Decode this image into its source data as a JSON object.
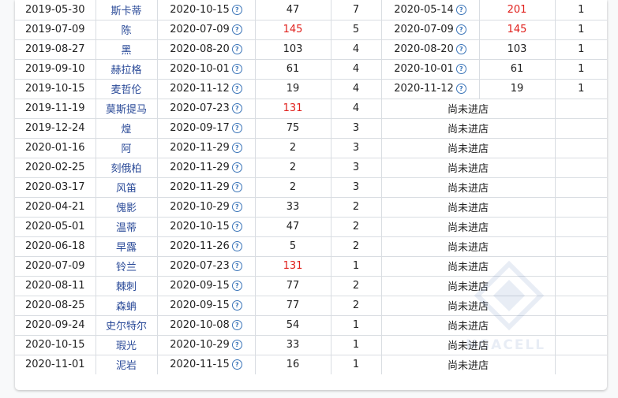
{
  "colors": {
    "accent": "#2a4a98",
    "highlight_red": "#e0201c",
    "border": "#d9dde2",
    "help_icon": "#3a74b8"
  },
  "icons": {
    "date_help": "question-circle-icon"
  },
  "rows": [
    {
      "release": "2019-05-30",
      "name": "斯卡蒂",
      "date": "2020-10-15",
      "days": "47",
      "count": "7",
      "red": false,
      "second": {
        "date": "2020-05-14",
        "days": "201",
        "count": "1",
        "red": true
      }
    },
    {
      "release": "2019-07-09",
      "name": "陈",
      "date": "2020-07-09",
      "days": "145",
      "count": "5",
      "red": true,
      "second": {
        "date": "2020-07-09",
        "days": "145",
        "count": "1",
        "red": true
      }
    },
    {
      "release": "2019-08-27",
      "name": "黑",
      "date": "2020-08-20",
      "days": "103",
      "count": "4",
      "red": false,
      "second": {
        "date": "2020-08-20",
        "days": "103",
        "count": "1",
        "red": false
      }
    },
    {
      "release": "2019-09-10",
      "name": "赫拉格",
      "date": "2020-10-01",
      "days": "61",
      "count": "4",
      "red": false,
      "second": {
        "date": "2020-10-01",
        "days": "61",
        "count": "1",
        "red": false
      }
    },
    {
      "release": "2019-10-15",
      "name": "麦哲伦",
      "date": "2020-11-12",
      "days": "19",
      "count": "4",
      "red": false,
      "second": {
        "date": "2020-11-12",
        "days": "19",
        "count": "1",
        "red": false
      }
    },
    {
      "release": "2019-11-19",
      "name": "莫斯提马",
      "date": "2020-07-23",
      "days": "131",
      "count": "4",
      "red": true,
      "status": "尚未进店"
    },
    {
      "release": "2019-12-24",
      "name": "煌",
      "date": "2020-09-17",
      "days": "75",
      "count": "3",
      "red": false,
      "status": "尚未进店"
    },
    {
      "release": "2020-01-16",
      "name": "阿",
      "date": "2020-11-29",
      "days": "2",
      "count": "3",
      "red": false,
      "status": "尚未进店"
    },
    {
      "release": "2020-02-25",
      "name": "刻俄柏",
      "date": "2020-11-29",
      "days": "2",
      "count": "3",
      "red": false,
      "status": "尚未进店"
    },
    {
      "release": "2020-03-17",
      "name": "风笛",
      "date": "2020-11-29",
      "days": "2",
      "count": "3",
      "red": false,
      "status": "尚未进店"
    },
    {
      "release": "2020-04-21",
      "name": "傀影",
      "date": "2020-10-29",
      "days": "33",
      "count": "2",
      "red": false,
      "status": "尚未进店"
    },
    {
      "release": "2020-05-01",
      "name": "温蒂",
      "date": "2020-10-15",
      "days": "47",
      "count": "2",
      "red": false,
      "status": "尚未进店"
    },
    {
      "release": "2020-06-18",
      "name": "早露",
      "date": "2020-11-26",
      "days": "5",
      "count": "2",
      "red": false,
      "status": "尚未进店"
    },
    {
      "release": "2020-07-09",
      "name": "铃兰",
      "date": "2020-07-23",
      "days": "131",
      "count": "1",
      "red": true,
      "status": "尚未进店"
    },
    {
      "release": "2020-08-11",
      "name": "棘刺",
      "date": "2020-09-15",
      "days": "77",
      "count": "2",
      "red": false,
      "status": "尚未进店"
    },
    {
      "release": "2020-08-25",
      "name": "森蚺",
      "date": "2020-09-15",
      "days": "77",
      "count": "2",
      "red": false,
      "status": "尚未进店"
    },
    {
      "release": "2020-09-24",
      "name": "史尔特尔",
      "date": "2020-10-08",
      "days": "54",
      "count": "1",
      "red": false,
      "status": "尚未进店"
    },
    {
      "release": "2020-10-15",
      "name": "瑕光",
      "date": "2020-10-29",
      "days": "33",
      "count": "1",
      "red": false,
      "status": "尚未进店"
    },
    {
      "release": "2020-11-01",
      "name": "泥岩",
      "date": "2020-11-15",
      "days": "16",
      "count": "1",
      "red": false,
      "status": "尚未进店"
    }
  ]
}
